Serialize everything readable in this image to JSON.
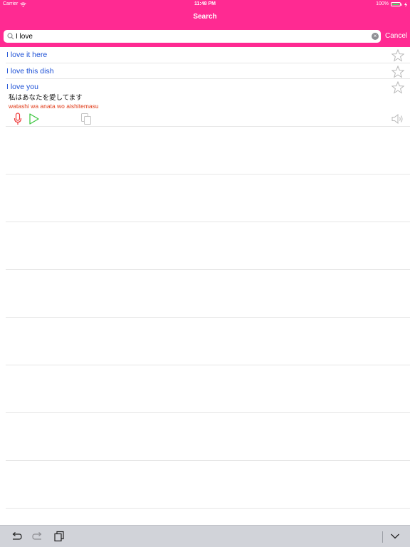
{
  "status_bar": {
    "carrier": "Carrier",
    "time": "11:48 PM",
    "battery_percent": "100%",
    "battery_level": 1.0
  },
  "nav": {
    "title": "Search"
  },
  "search": {
    "value": "I love",
    "cancel_label": "Cancel"
  },
  "results": [
    {
      "text": "I love it here"
    },
    {
      "text": "I love this dish"
    },
    {
      "text": "I love you",
      "japanese": "私はあなたを愛してます",
      "romaji": "watashi wa anata wo aishitemasu"
    }
  ],
  "colors": {
    "accent": "#ff2a92",
    "link_blue": "#1b4fd6",
    "romaji_red": "#e03a17",
    "mic_red": "#ee3b3b",
    "play_green": "#37c43a"
  },
  "icons": {
    "search": "search-icon",
    "clear": "clear-icon",
    "star": "star-icon",
    "mic": "mic-icon",
    "play": "play-icon",
    "copy": "copy-icon",
    "speaker": "speaker-icon",
    "undo": "undo-icon",
    "redo": "redo-icon",
    "paste": "paste-icon",
    "dismiss": "chevron-down-icon"
  }
}
